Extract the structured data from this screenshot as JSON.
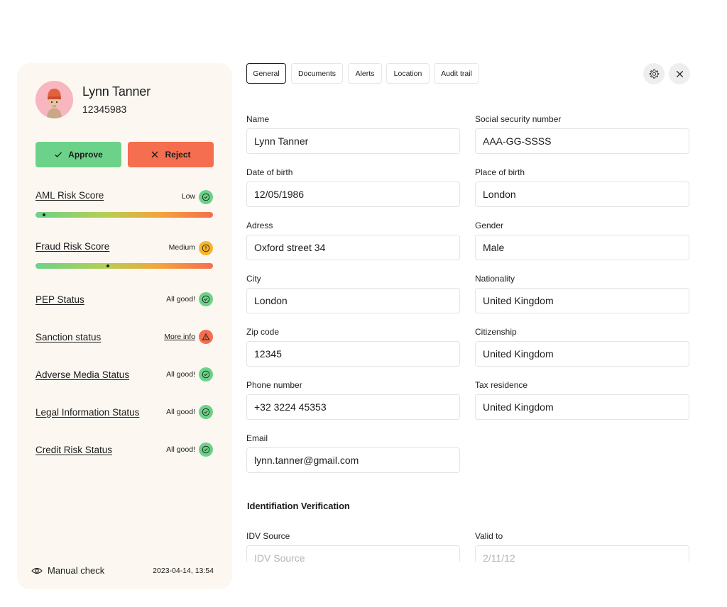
{
  "user": {
    "name": "Lynn Tanner",
    "id": "12345983"
  },
  "actions": {
    "approve_label": "Approve",
    "reject_label": "Reject"
  },
  "scores": [
    {
      "title": "AML Risk Score",
      "status": "Low",
      "state": "good",
      "level": 0.04
    },
    {
      "title": "Fraud Risk Score",
      "status": "Medium",
      "state": "warn",
      "level": 0.4
    },
    {
      "title": "PEP Status",
      "status": "All good!",
      "state": "good"
    },
    {
      "title": "Sanction status",
      "status": "More info",
      "state": "alert"
    },
    {
      "title": "Adverse Media Status",
      "status": "All good!",
      "state": "good"
    },
    {
      "title": "Legal Information Status",
      "status": "All good!",
      "state": "good"
    },
    {
      "title": "Credit Risk Status",
      "status": "All good!",
      "state": "good"
    }
  ],
  "footer": {
    "check_label": "Manual check",
    "date": "2023-04-14, 13:54"
  },
  "tabs": [
    "General",
    "Documents",
    "Alerts",
    "Location",
    "Audit trail"
  ],
  "form": {
    "name": {
      "label": "Name",
      "value": "Lynn Tanner"
    },
    "ssn": {
      "label": "Social security number",
      "value": "AAA-GG-SSSS"
    },
    "dob": {
      "label": "Date of birth",
      "value": "12/05/1986"
    },
    "pob": {
      "label": "Place of birth",
      "value": "London"
    },
    "address": {
      "label": "Adress",
      "value": "Oxford street 34"
    },
    "gender": {
      "label": "Gender",
      "value": "Male"
    },
    "city": {
      "label": "City",
      "value": "London"
    },
    "nationality": {
      "label": "Nationality",
      "value": "United Kingdom"
    },
    "zip": {
      "label": "Zip code",
      "value": "12345"
    },
    "citizenship": {
      "label": "Citizenship",
      "value": "United Kingdom"
    },
    "phone": {
      "label": "Phone number",
      "value": "+32 3224 45353"
    },
    "tax": {
      "label": "Tax residence",
      "value": "United Kingdom"
    },
    "email": {
      "label": "Email",
      "value": "lynn.tanner@gmail.com"
    },
    "idv_section": "Identifiation Verification",
    "idv_source": {
      "label": "IDV Source",
      "placeholder": "IDV Source"
    },
    "valid_to": {
      "label": "Valid to",
      "placeholder": "2/11/12"
    }
  },
  "colors": {
    "approve": "#6cd28a",
    "reject": "#f56e4f",
    "warn": "#f5b52d",
    "panel": "#fcf8f1"
  }
}
